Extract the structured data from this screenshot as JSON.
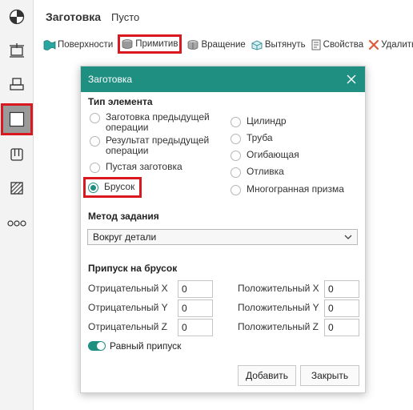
{
  "header": {
    "title": "Заготовка",
    "subtitle": "Пусто"
  },
  "toolbar": {
    "items": [
      {
        "label": "Поверхности",
        "icon": "surface-icon"
      },
      {
        "label": "Примитив",
        "icon": "primitive-icon",
        "highlighted": true
      },
      {
        "label": "Вращение",
        "icon": "rotation-icon"
      },
      {
        "label": "Вытянуть",
        "icon": "extrude-icon"
      },
      {
        "label": "Свойства",
        "icon": "properties-icon"
      },
      {
        "label": "Удалить",
        "icon": "delete-icon"
      }
    ]
  },
  "leftbar": {
    "items": [
      "stock-origin-icon",
      "align-icon",
      "layer-icon",
      "square-icon",
      "clamp-icon",
      "hatch-icon",
      "more-icon"
    ],
    "selected": "square-icon"
  },
  "dialog": {
    "title": "Заготовка",
    "element_type_label": "Тип элемента",
    "left_options": [
      "Заготовка предыдущей\nоперации",
      "Результат предыдущей\nоперации",
      "Пустая заготовка",
      "Брусок"
    ],
    "right_options": [
      "Цилиндр",
      "Труба",
      "Огибающая",
      "Отливка",
      "Многогранная призма"
    ],
    "selected_option": "Брусок",
    "method_label": "Метод задания",
    "method_value": "Вокруг детали",
    "allowance_label": "Припуск на брусок",
    "neg_x_label": "Отрицательный X",
    "neg_y_label": "Отрицательный Y",
    "neg_z_label": "Отрицательный Z",
    "pos_x_label": "Положительный X",
    "pos_y_label": "Положительный Y",
    "pos_z_label": "Положительный Z",
    "neg_x": "0",
    "neg_y": "0",
    "neg_z": "0",
    "pos_x": "0",
    "pos_y": "0",
    "pos_z": "0",
    "equal_allowance_label": "Равный припуск",
    "equal_allowance_on": true,
    "add_button": "Добавить",
    "close_button": "Закрыть"
  },
  "colors": {
    "accent": "#1f8f82",
    "highlight": "#d9181f"
  }
}
